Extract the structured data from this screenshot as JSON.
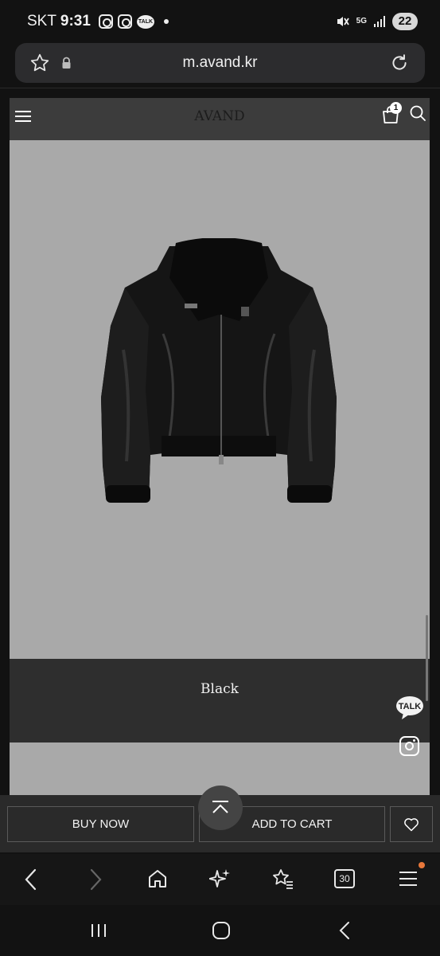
{
  "status_bar": {
    "carrier": "SKT",
    "time": "9:31",
    "network": "5G",
    "battery": "22"
  },
  "browser": {
    "url": "m.avand.kr",
    "tab_count": "30"
  },
  "site": {
    "logo": "AVAND",
    "cart_count": "1"
  },
  "product": {
    "color_name": "Black"
  },
  "floating": {
    "kakao_label": "TALK"
  },
  "actions": {
    "buy_now": "BUY NOW",
    "add_to_cart": "ADD TO CART"
  },
  "colors": {
    "page_bg": "#2e2e2e",
    "header_bg": "#3c3c3c",
    "image_bg": "#a9a9a9",
    "notification": "#e8773a"
  }
}
